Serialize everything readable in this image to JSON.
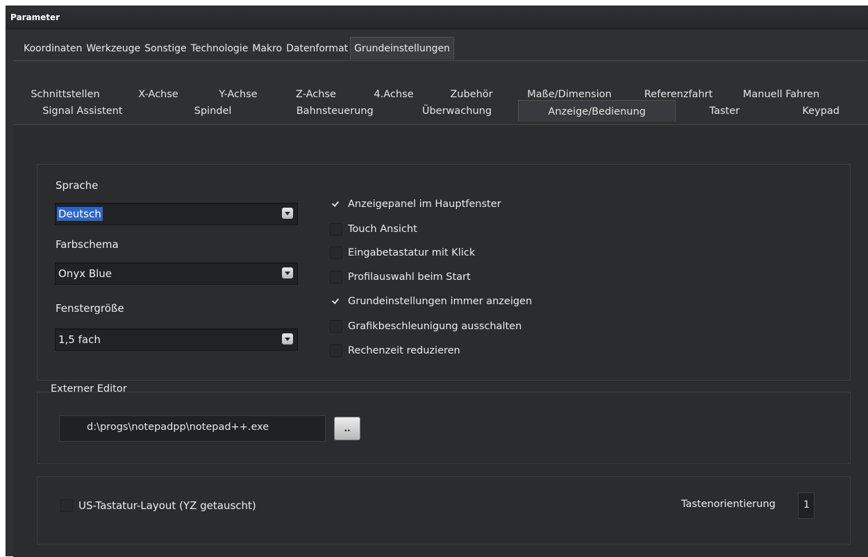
{
  "window": {
    "title": "Parameter"
  },
  "top_tabs": [
    {
      "label": "Koordinaten",
      "active": false
    },
    {
      "label": "Werkzeuge",
      "active": false
    },
    {
      "label": "Sonstige",
      "active": false
    },
    {
      "label": "Technologie",
      "active": false
    },
    {
      "label": "Makro",
      "active": false
    },
    {
      "label": "Datenformat",
      "active": false
    },
    {
      "label": "Grundeinstellungen",
      "active": true
    }
  ],
  "sub_tabs_row1": [
    {
      "label": "Schnittstellen"
    },
    {
      "label": "X-Achse"
    },
    {
      "label": "Y-Achse"
    },
    {
      "label": "Z-Achse"
    },
    {
      "label": "4.Achse"
    },
    {
      "label": "Zubehör"
    },
    {
      "label": "Maße/Dimension"
    },
    {
      "label": "Referenzfahrt"
    },
    {
      "label": "Manuell Fahren"
    }
  ],
  "sub_tabs_row2": [
    {
      "label": "Signal Assistent",
      "active": false
    },
    {
      "label": "Spindel",
      "active": false
    },
    {
      "label": "Bahnsteuerung",
      "active": false
    },
    {
      "label": "Überwachung",
      "active": false
    },
    {
      "label": "Anzeige/Bedienung",
      "active": true
    },
    {
      "label": "Taster",
      "active": false
    },
    {
      "label": "Keypad",
      "active": false
    }
  ],
  "settings": {
    "language_label": "Sprache",
    "language_value": "Deutsch",
    "scheme_label": "Farbschema",
    "scheme_value": "Onyx Blue",
    "size_label": "Fenstergröße",
    "size_value": "1,5 fach"
  },
  "checkboxes": [
    {
      "label": "Anzeigepanel im Hauptfenster",
      "checked": true
    },
    {
      "label": "Touch Ansicht",
      "checked": false
    },
    {
      "label": "Eingabetastatur mit Klick",
      "checked": false
    },
    {
      "label": "Profilauswahl beim Start",
      "checked": false
    },
    {
      "label": "Grundeinstellungen immer anzeigen",
      "checked": true
    },
    {
      "label": "Grafikbeschleunigung ausschalten",
      "checked": false
    },
    {
      "label": "Rechenzeit reduzieren",
      "checked": false
    }
  ],
  "external_editor": {
    "label": "Externer Editor",
    "path": "d:\\progs\\notepadpp\\notepad++.exe",
    "browse_label": ".."
  },
  "keyboard": {
    "us_layout_label": "US-Tastatur-Layout (YZ getauscht)",
    "us_layout_checked": false,
    "orientation_label": "Tastenorientierung",
    "orientation_value": "1"
  }
}
